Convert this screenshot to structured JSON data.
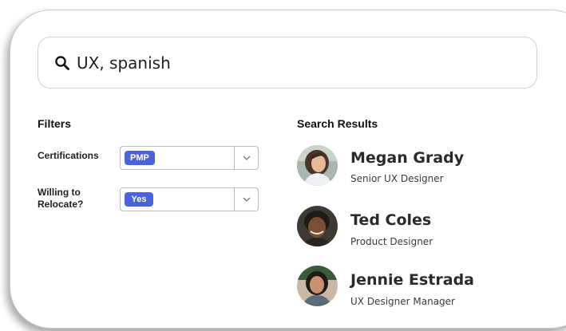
{
  "search": {
    "value": "UX, spanish",
    "icon": "search-icon"
  },
  "filters": {
    "heading": "Filters",
    "items": [
      {
        "label_line1": "Certifications",
        "label_line2": "",
        "selected": "PMP"
      },
      {
        "label_line1": "Willing to",
        "label_line2": "Relocate?",
        "selected": "Yes"
      }
    ]
  },
  "results": {
    "heading": "Search Results",
    "items": [
      {
        "name": "Megan Grady",
        "title": "Senior UX Designer"
      },
      {
        "name": "Ted Coles",
        "title": "Product Designer"
      },
      {
        "name": "Jennie Estrada",
        "title": "UX Designer Manager"
      }
    ]
  },
  "colors": {
    "chip": "#4b63d8",
    "border": "#d2d2d2"
  }
}
